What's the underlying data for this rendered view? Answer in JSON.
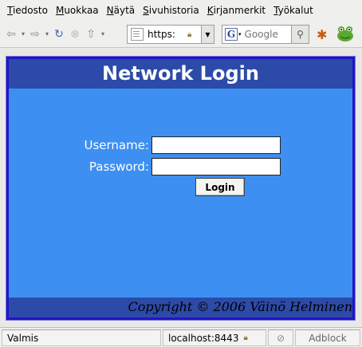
{
  "menubar": {
    "items": [
      "Tiedosto",
      "Muokkaa",
      "Näytä",
      "Sivuhistoria",
      "Kirjanmerkit",
      "Työkalut"
    ]
  },
  "toolbar": {
    "back_icon": "back-arrow-icon",
    "forward_icon": "forward-arrow-icon",
    "reload_icon": "reload-icon",
    "stop_icon": "stop-icon",
    "home_icon": "home-icon",
    "url_text": "https:",
    "search_placeholder": "Google",
    "search_engine_letter": "G"
  },
  "page": {
    "header_title": "Network Login",
    "username_label": "Username:",
    "password_label": "Password:",
    "username_value": "",
    "password_value": "",
    "login_button_label": "Login",
    "footer_text": "Copyright © 2006 Väinö Helminen",
    "colors": {
      "background": "#3d8ff2",
      "header": "#2c4aa8",
      "border": "#2214c8"
    }
  },
  "statusbar": {
    "status_text": "Valmis",
    "host_text": "localhost:8443",
    "adblock_label": "Adblock"
  }
}
